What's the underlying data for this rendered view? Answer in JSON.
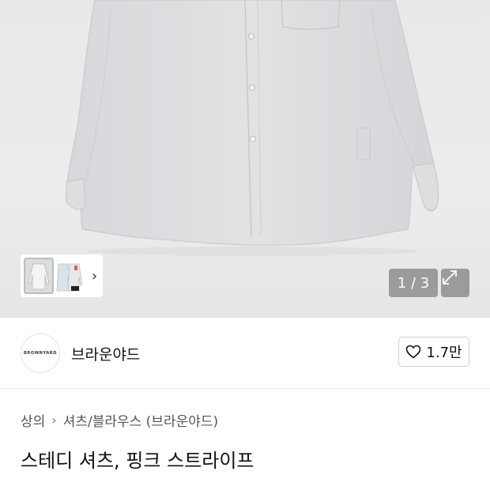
{
  "gallery": {
    "counter": "1 / 3",
    "thumbnail_next_icon": "chevron-right-icon",
    "expand_icon": "expand-arrows-icon"
  },
  "brand": {
    "logo_text": "BROWNYARD",
    "name": "브라운야드",
    "like_count": "1.7만",
    "like_icon": "heart-outline-icon"
  },
  "breadcrumb": {
    "category": "상의",
    "separator_icon": "chevron-right-icon",
    "subcategory": "셔츠/블라우스 (브라운야드)"
  },
  "product": {
    "title": "스테디 셔츠, 핑크 스트라이프"
  }
}
